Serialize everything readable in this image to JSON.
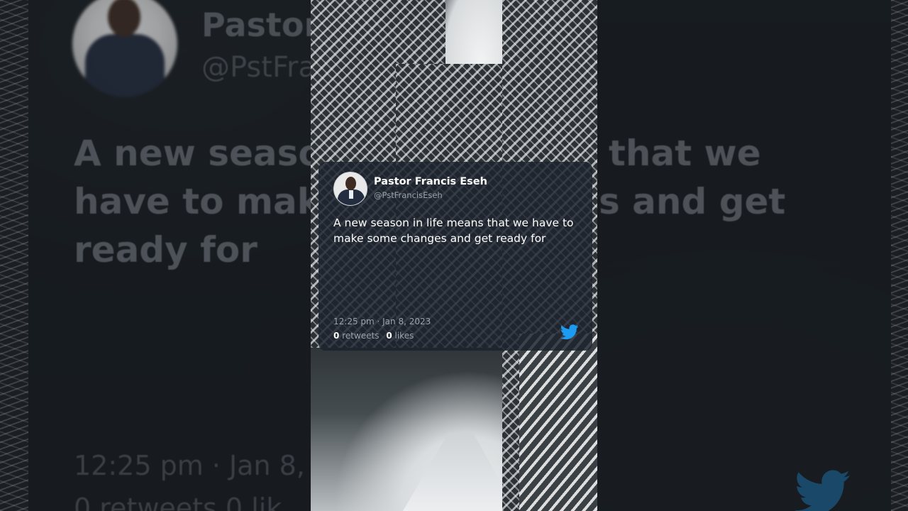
{
  "tweet": {
    "name": "Pastor Francis Eseh",
    "handle": "@PstFrancisEseh",
    "text": "A new season in life means that we have to make some changes and get ready for",
    "timestamp": "12:25 pm · Jan 8, 2023",
    "retweets_count": "0",
    "retweets_label": "retweets",
    "likes_count": "0",
    "likes_label": "likes",
    "icon": "twitter-bird-icon",
    "icon_color": "#1d9bf0"
  },
  "background": {
    "name_visible": "Pastor",
    "handle_visible": "@PstFra",
    "text_line1": "A new seaso",
    "text_line1_right": "that we",
    "text_line2": "have to mak",
    "text_line2_right": "s and get",
    "text_line3": "ready for",
    "time_visible": "12:25 pm · Jan 8,",
    "stats_visible": "0 retweets  0 lik"
  },
  "colors": {
    "card_bg": "#1d232d",
    "text_primary": "#ffffff",
    "text_secondary": "#9aa3ad"
  }
}
